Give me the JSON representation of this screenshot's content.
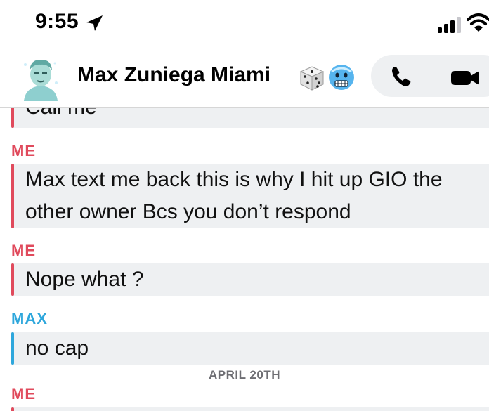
{
  "status_bar": {
    "time": "9:55",
    "icons": [
      "location-arrow-icon",
      "signal-icon",
      "wifi-icon"
    ]
  },
  "header": {
    "contact_name": "Max Zuniega Miami",
    "name_emojis": [
      "game-die-icon",
      "cold-face-icon"
    ],
    "actions": [
      "phone-icon",
      "video-icon"
    ]
  },
  "messages": [
    {
      "sender": "",
      "text": "Call me",
      "color": "#e04a5c"
    },
    {
      "sender": "ME",
      "text": [
        "Max text me back this is why I hit up GIO the",
        "other owner Bcs you don’t respond"
      ],
      "color": "#e04a5c"
    },
    {
      "sender": "ME",
      "text": "Nope what ?",
      "color": "#e04a5c"
    },
    {
      "sender": "MAX",
      "text": "no cap",
      "color": "#2ea7dc"
    }
  ],
  "date_separator": "APRIL 20TH",
  "next_sender": "ME",
  "colors": {
    "me": "#e04a5c",
    "max": "#2ea7dc",
    "bubble_bg": "#eef0f2"
  }
}
